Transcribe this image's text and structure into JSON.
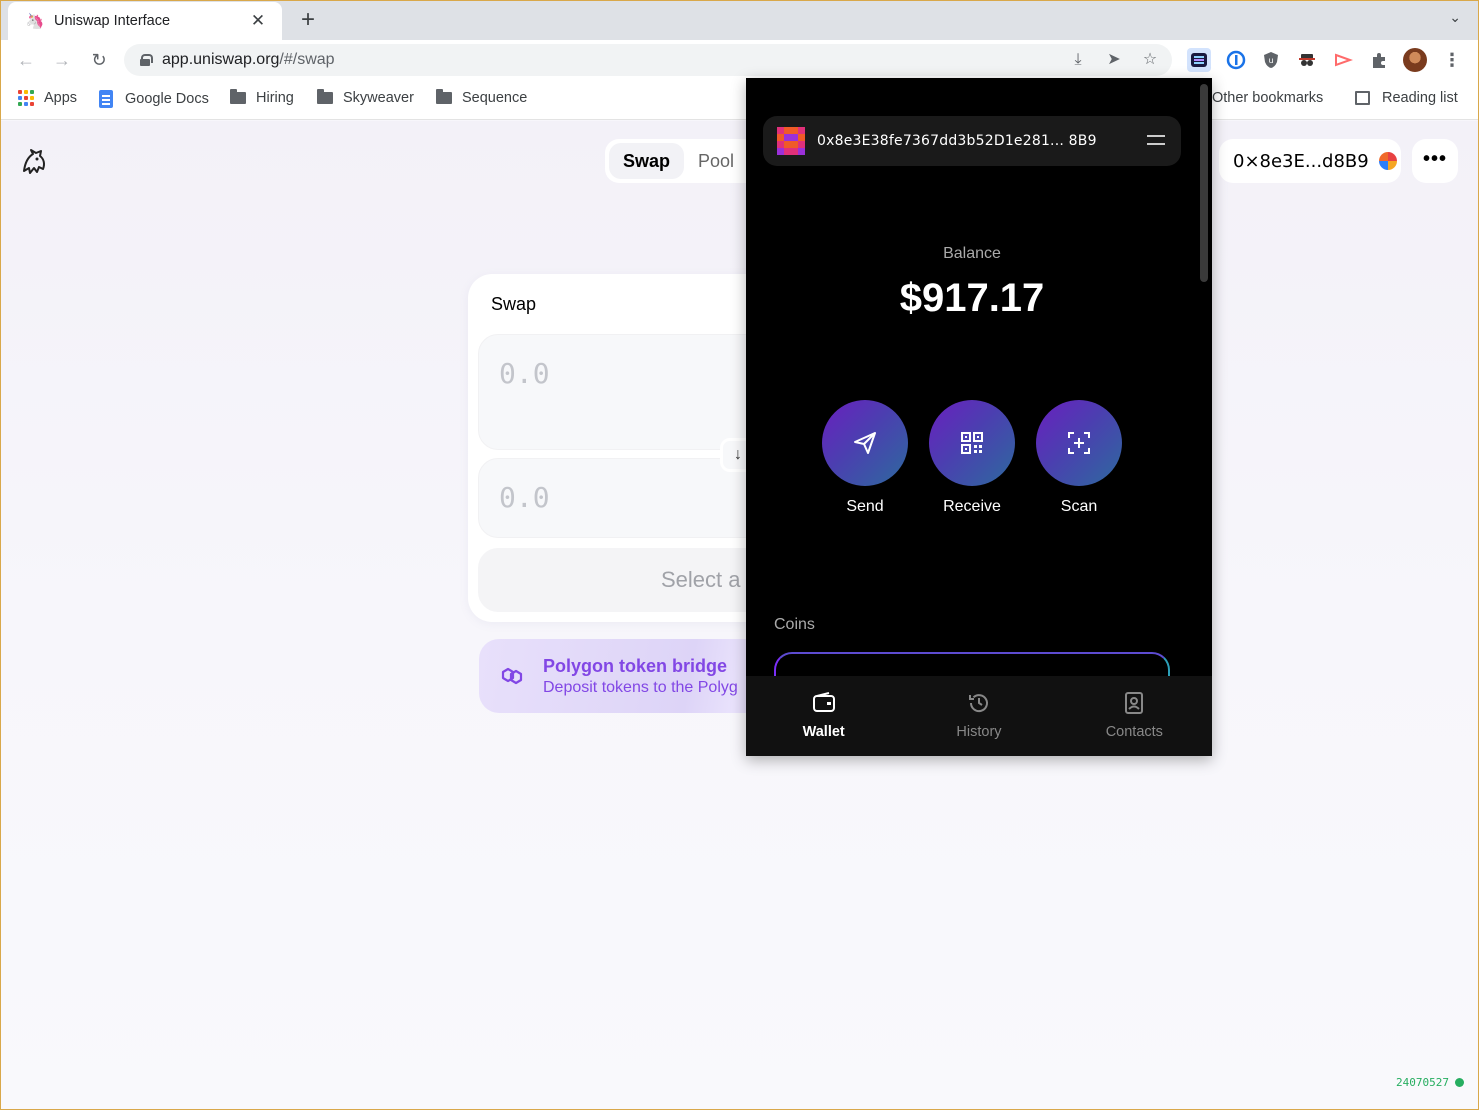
{
  "browser": {
    "tab_title": "Uniswap Interface",
    "url_host": "app.uniswap.org",
    "url_path": "/#/swap",
    "bookmarks": [
      {
        "label": "Apps"
      },
      {
        "label": "Google Docs"
      },
      {
        "label": "Hiring"
      },
      {
        "label": "Skyweaver"
      },
      {
        "label": "Sequence"
      }
    ],
    "other_bookmarks": "Other bookmarks",
    "reading_list": "Reading list"
  },
  "uniswap": {
    "nav": {
      "swap": "Swap",
      "pool": "Pool"
    },
    "account": "0×8e3E...d8B9",
    "more": "•••",
    "swap_card": {
      "title": "Swap",
      "input_placeholder": "0.0",
      "output_placeholder": "0.0",
      "select_label": "Select a"
    },
    "bridge": {
      "title": "Polygon token bridge",
      "subtitle": "Deposit tokens to the Polyg"
    },
    "build": "24070527"
  },
  "wallet": {
    "address": "0x8e3E38fe7367dd3b52D1e281... 8B9",
    "balance_label": "Balance",
    "balance": "$917.17",
    "actions": [
      {
        "label": "Send"
      },
      {
        "label": "Receive"
      },
      {
        "label": "Scan"
      }
    ],
    "coins_label": "Coins",
    "nav": [
      {
        "label": "Wallet",
        "active": true
      },
      {
        "label": "History",
        "active": false
      },
      {
        "label": "Contacts",
        "active": false
      }
    ]
  }
}
